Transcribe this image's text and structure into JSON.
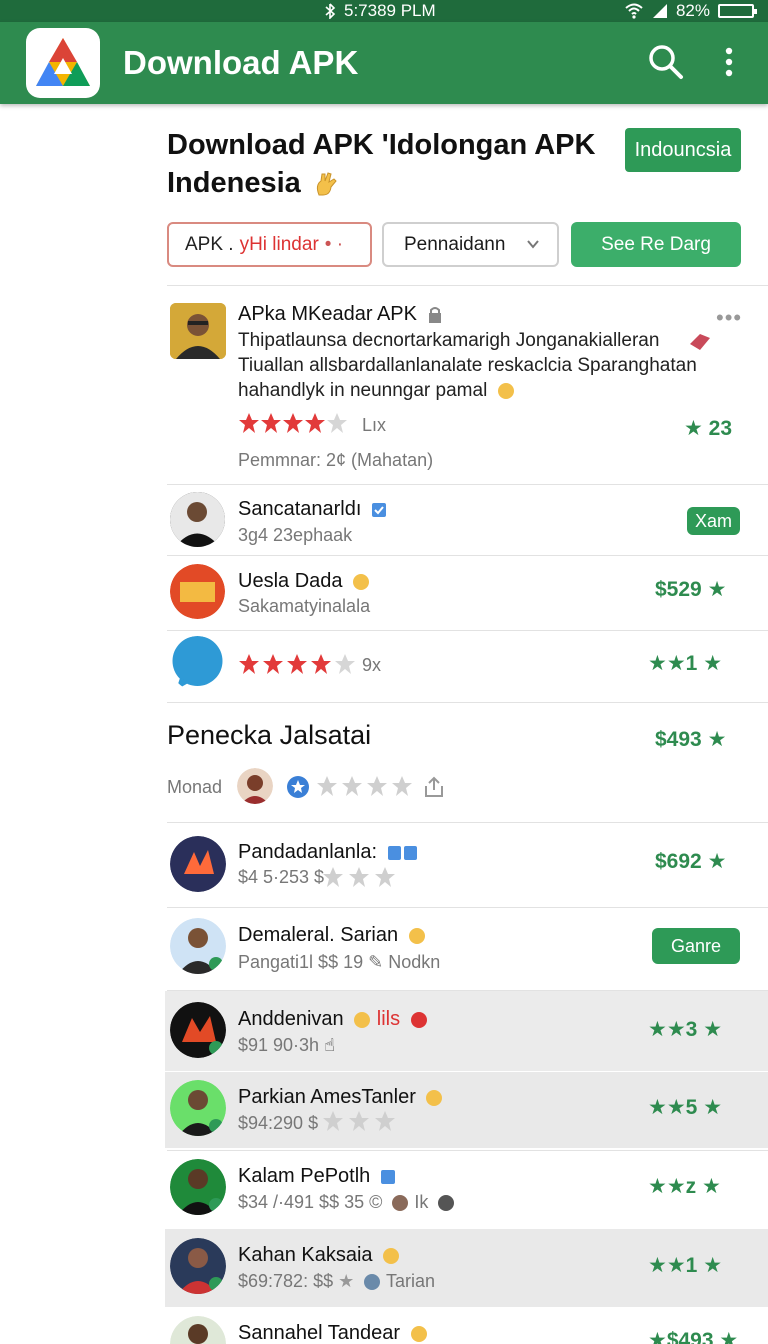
{
  "status_bar": {
    "time": "5:7389 PLM",
    "battery": "82%"
  },
  "app_bar": {
    "title": "Download APK",
    "icons": [
      "app-logo-icon",
      "search-icon",
      "more-vert-icon"
    ]
  },
  "header": {
    "title_line1": "Download APK 'Idolongan APK",
    "title_line2": "Indenesia",
    "region_button": "Indouncsia"
  },
  "filters": {
    "input_prefix": "APK .",
    "input_accent": "yHi lindar",
    "select": "Pennaidann",
    "button": "See Re Darg"
  },
  "featured": {
    "name": "APka MKeadar APK",
    "description": "Thipatlaunsa decnortarkamarigh Jonganakialleran Tiuallan allsbardallanlanalate reskaclcia Sparanghatan hahandlyk in neunngar pamal",
    "rating_label": "Lıx",
    "score": "23",
    "footer": "Pemmnar: 2¢ (Mahatan)"
  },
  "list_top": [
    {
      "name": "Sancatanarldı",
      "sub": "3g4 23ephaak",
      "action": "Xam"
    },
    {
      "name": "Uesla Dada",
      "sub": "Sakamatyinalala",
      "score": "$529"
    },
    {
      "rating_label": "9x",
      "score": "1"
    }
  ],
  "section": {
    "title": "Penecka Jalsatai",
    "score": "$493",
    "meta_label": "Monad"
  },
  "list_bottom": [
    {
      "name": "Pandadanlanla:",
      "sub": "$4 5·253 $",
      "score": "$692"
    },
    {
      "name": "Demaleral. Sarian",
      "sub": "Pangati1l $$ 19",
      "sub2": "Nodkn",
      "action": "Ganre"
    },
    {
      "name": "Anddenivan",
      "name_tag": "lils",
      "sub": "$91 90·3h",
      "score": "3"
    },
    {
      "name": "Parkian AmesTanler",
      "sub": "$94:290 $",
      "score": "5"
    },
    {
      "name": "Kalam PePotlh",
      "sub": "$34 /·491 $$ 35 ©",
      "sub2": "Ik",
      "score": "z"
    },
    {
      "name": "Kahan Kaksaia",
      "sub": "$69:782: $$",
      "sub2": "Tarian",
      "score": "1"
    },
    {
      "name": "Sannahel Tandear",
      "score": "$493"
    }
  ],
  "colors": {
    "primary": "#2e8b4f",
    "star_red": "#e23a3a",
    "star_green": "#2e8b4f",
    "star_grey": "#cfcfcf"
  }
}
